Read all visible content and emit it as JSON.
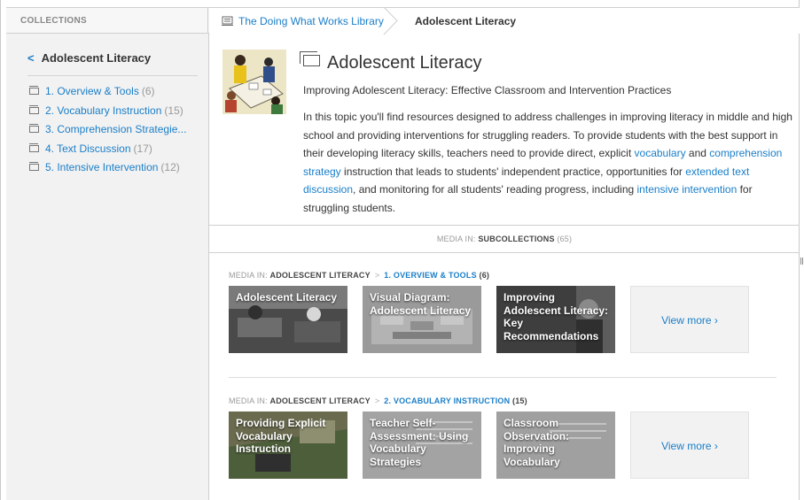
{
  "colors": {
    "link": "#1a7ec8",
    "sidebar_bg": "#f2f2f2",
    "text": "#333333",
    "muted": "#999999"
  },
  "header": {
    "collections_label": "COLLECTIONS",
    "breadcrumb_link": "The Doing What Works Library",
    "breadcrumb_current": "Adolescent Literacy"
  },
  "sidebar": {
    "title": "Adolescent Literacy",
    "items": [
      {
        "label": "1. Overview & Tools",
        "count": "(6)"
      },
      {
        "label": "2. Vocabulary Instruction",
        "count": "(15)"
      },
      {
        "label": "3. Comprehension Strategie...",
        "count": ""
      },
      {
        "label": "4. Text Discussion",
        "count": "(17)"
      },
      {
        "label": "5. Intensive Intervention",
        "count": "(12)"
      }
    ]
  },
  "main": {
    "title": "Adolescent Literacy",
    "subtitle": "Improving Adolescent Literacy: Effective Classroom and Intervention Practices",
    "desc": {
      "p1": "In this topic you'll find resources designed to address challenges in improving literacy in middle and high school and providing interventions for struggling readers. To provide students with the best support in their developing literacy skills, teachers need to provide direct, explicit ",
      "link1": "vocabulary",
      "p2": " and ",
      "link2": "comprehension strategy",
      "p3": " instruction that leads to students' independent practice, opportunities for ",
      "link3": "extended text discussion",
      "p4": ", and monitoring for all students' reading progress, including ",
      "link4": "intensive intervention",
      "p5": " for struggling students."
    },
    "subcollections_bar": {
      "prefix": "MEDIA IN: ",
      "label": "SUBCOLLECTIONS",
      "count": "(65)"
    },
    "sections": [
      {
        "prefix": "MEDIA IN: ",
        "parent": "ADOLESCENT LITERACY",
        "sep": ">",
        "child": "1. OVERVIEW & TOOLS",
        "count": "(6)",
        "cards": [
          "Adolescent Literacy",
          "Visual Diagram: Adolescent Literacy",
          "Improving Adolescent Literacy: Key Recommendations"
        ],
        "view_more": "View more ›"
      },
      {
        "prefix": "MEDIA IN: ",
        "parent": "ADOLESCENT LITERACY",
        "sep": ">",
        "child": "2. VOCABULARY INSTRUCTION",
        "count": "(15)",
        "cards": [
          "Providing Explicit Vocabulary Instruction",
          "Teacher Self-Assessment: Using Vocabulary Strategies",
          "Classroom Observation: Improving Vocabulary"
        ],
        "view_more": "View more ›"
      }
    ]
  }
}
